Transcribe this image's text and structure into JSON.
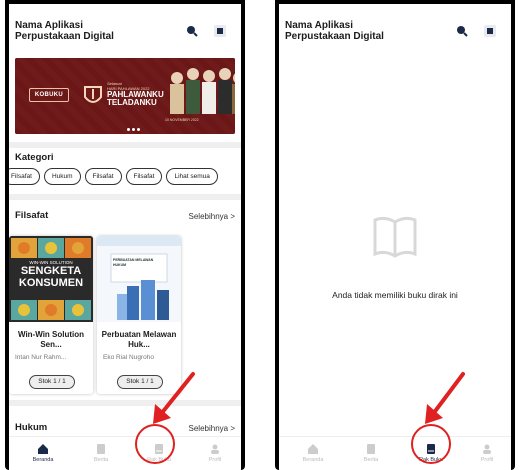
{
  "app": {
    "title_line1": "Nama Aplikasi",
    "title_line2": "Perpustakaan Digital"
  },
  "banner": {
    "brand": "KOBUKU",
    "line1": "Selamat",
    "line2": "HARI PAHLAWAN 2022",
    "line3a": "PAHLAWANKU",
    "line3b": "TELADANKU",
    "date": "10 NOVEMBER 2022"
  },
  "kategori": {
    "title": "Kategori",
    "chips": [
      "Filsafat",
      "Hukum",
      "Filsafat",
      "Filsafat",
      "Lihat semua"
    ]
  },
  "filsafat": {
    "title": "Filsafat",
    "more": "Selebihnya >"
  },
  "books": [
    {
      "title": "Win-Win Solution Sen...",
      "author": "Intan Nur Rahm...",
      "stock": "Stok 1 / 1",
      "cover_top": "WIN-WIN SOLUTION",
      "cover_mid": "SENGKETA",
      "cover_bot": "KONSUMEN"
    },
    {
      "title": "Perbuatan Melawan Huk...",
      "author": "Eko Rial Nugroho",
      "stock": "Stok 1 / 1",
      "cover_text": "PERBUATAN MELAWAN HUKUM"
    }
  ],
  "hukum": {
    "title": "Hukum",
    "more": "Selebihnya >"
  },
  "nav": [
    "Beranda",
    "Berita",
    "Rak Buku",
    "Profil"
  ],
  "empty": {
    "message": "Anda tidak memiliki buku dirak ini"
  },
  "colors": {
    "highlight": "#e02121",
    "banner": "#6b1717",
    "nav_active": "#1c2a4a"
  }
}
